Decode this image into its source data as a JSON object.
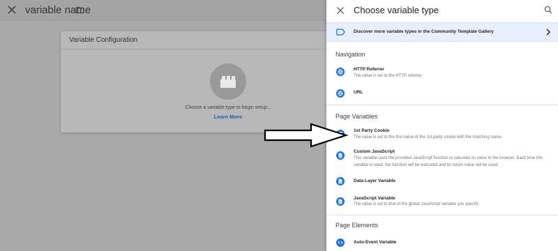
{
  "editor": {
    "title": "variable name",
    "config_card": {
      "header": "Variable Configuration",
      "hint": "Choose a variable type to begin setup...",
      "learn_more": "Learn More"
    }
  },
  "panel": {
    "title": "Choose variable type",
    "gallery_banner": "Discover more variable types in the Community Template Gallery",
    "sections": {
      "navigation": {
        "title": "Navigation",
        "items": [
          {
            "title": "HTTP Referrer",
            "desc": "The value is set to the HTTP referrer.",
            "icon": "globe-icon"
          },
          {
            "title": "URL",
            "desc": "",
            "icon": "globe-icon"
          }
        ]
      },
      "page_variables": {
        "title": "Page Variables",
        "items": [
          {
            "title": "1st Party Cookie",
            "desc": "The value is set to the first value of the 1st party cookie with the matching name.",
            "icon": "cookie-icon"
          },
          {
            "title": "Custom JavaScript",
            "desc": "This variable uses the provided JavaScript function to calculate its value in the browser. Each time this variable is used, the function will be executed and its return value will be used.",
            "icon": "document-icon"
          },
          {
            "title": "Data Layer Variable",
            "desc": "",
            "icon": "document-icon"
          },
          {
            "title": "JavaScript Variable",
            "desc": "The value is set to that of the global JavaScript variable you specify.",
            "icon": "document-icon"
          }
        ]
      },
      "page_elements": {
        "title": "Page Elements",
        "items": [
          {
            "title": "Auto-Event Variable",
            "desc": "",
            "icon": "code-icon"
          }
        ]
      }
    }
  },
  "colors": {
    "accent": "#1a73e8",
    "banner_bg": "#e8f0fe",
    "overlay": "#ababab"
  }
}
